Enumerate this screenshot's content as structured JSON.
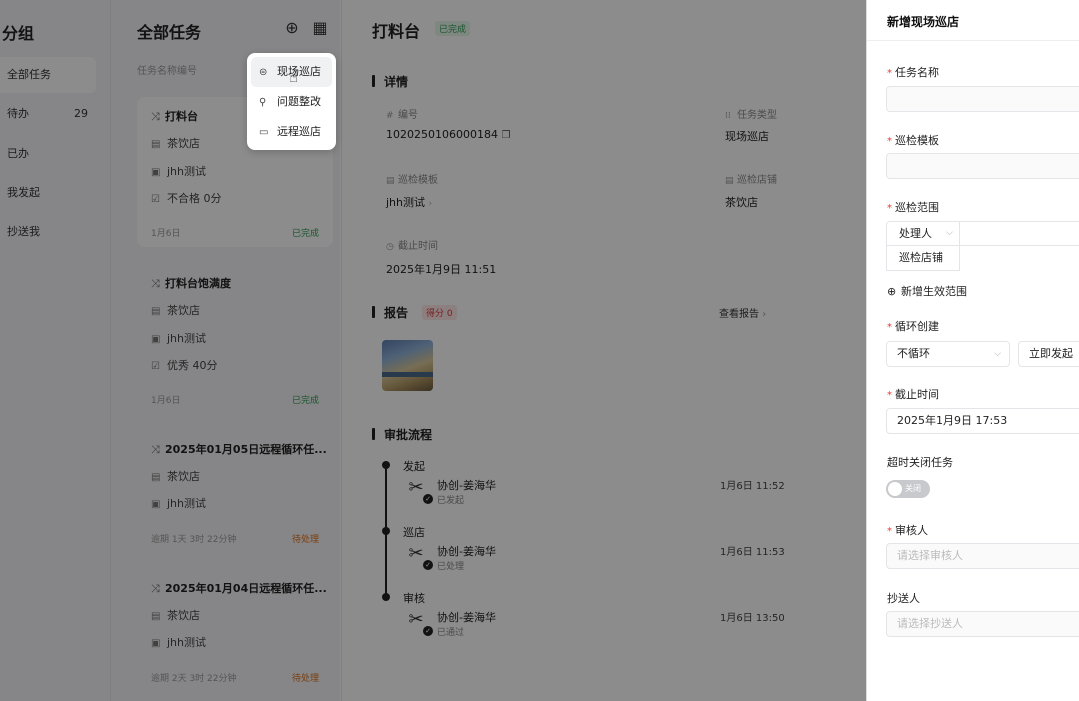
{
  "groups": {
    "title": "分组",
    "items": [
      {
        "label": "全部任务",
        "count": ""
      },
      {
        "label": "待办",
        "count": "29"
      },
      {
        "label": "已办",
        "count": ""
      },
      {
        "label": "我发起",
        "count": ""
      },
      {
        "label": "抄送我",
        "count": ""
      }
    ]
  },
  "tasks": {
    "title": "全部任务",
    "search_placeholder": "任务名称编号",
    "cards": [
      {
        "title": "打料台",
        "shop": "茶饮店",
        "template": "jhh测试",
        "score": "不合格 0分",
        "date": "1月6日",
        "status": "已完成"
      },
      {
        "title": "打料台饱满度",
        "shop": "茶饮店",
        "template": "jhh测试",
        "score": "优秀 40分",
        "date": "1月6日",
        "status": "已完成"
      },
      {
        "title": "2025年01月05日远程循环任...",
        "shop": "茶饮店",
        "template": "jhh测试",
        "date": "逾期 1天 3时 22分钟",
        "status": "待处理"
      },
      {
        "title": "2025年01月04日远程循环任...",
        "shop": "茶饮店",
        "template": "jhh测试",
        "date": "逾期 2天 3时 22分钟",
        "status": "待处理"
      }
    ]
  },
  "popup": {
    "items": [
      {
        "label": "现场巡店"
      },
      {
        "label": "问题整改"
      },
      {
        "label": "远程巡店"
      }
    ]
  },
  "detail": {
    "title": "打料台",
    "badge": "已完成",
    "section_details": "详情",
    "fields": {
      "number_label": "编号",
      "number_value": "1020250106000184",
      "type_label": "任务类型",
      "type_value": "现场巡店",
      "template_label": "巡检模板",
      "template_value": "jhh测试",
      "shop_label": "巡检店铺",
      "shop_value": "茶饮店",
      "deadline_label": "截止时间",
      "deadline_value": "2025年1月9日 11:51"
    },
    "section_report": "报告",
    "score_badge": "得分 0",
    "view_report": "查看报告",
    "section_approval": "审批流程",
    "timeline": [
      {
        "stage": "发起",
        "name": "协创-姜海华",
        "sub": "已发起",
        "time": "1月6日 11:52"
      },
      {
        "stage": "巡店",
        "name": "协创-姜海华",
        "sub": "已处理",
        "time": "1月6日 11:53"
      },
      {
        "stage": "审核",
        "name": "协创-姜海华",
        "sub": "已通过",
        "time": "1月6日 13:50"
      }
    ]
  },
  "drawer": {
    "title": "新增现场巡店",
    "task_name_label": "任务名称",
    "template_label": "巡检模板",
    "scope_label": "巡检范围",
    "scope_handler": "处理人",
    "scope_shop": "巡检店铺",
    "add_scope": "新增生效范围",
    "cycle_label": "循环创建",
    "cycle_value": "不循环",
    "cycle_button": "立即发起",
    "deadline_label": "截止时间",
    "deadline_value": "2025年1月9日 17:53",
    "timeout_label": "超时关闭任务",
    "toggle_text": "关闭",
    "reviewer_label": "审核人",
    "reviewer_placeholder": "请选择审核人",
    "cc_label": "抄送人",
    "cc_placeholder": "请选择抄送人"
  }
}
